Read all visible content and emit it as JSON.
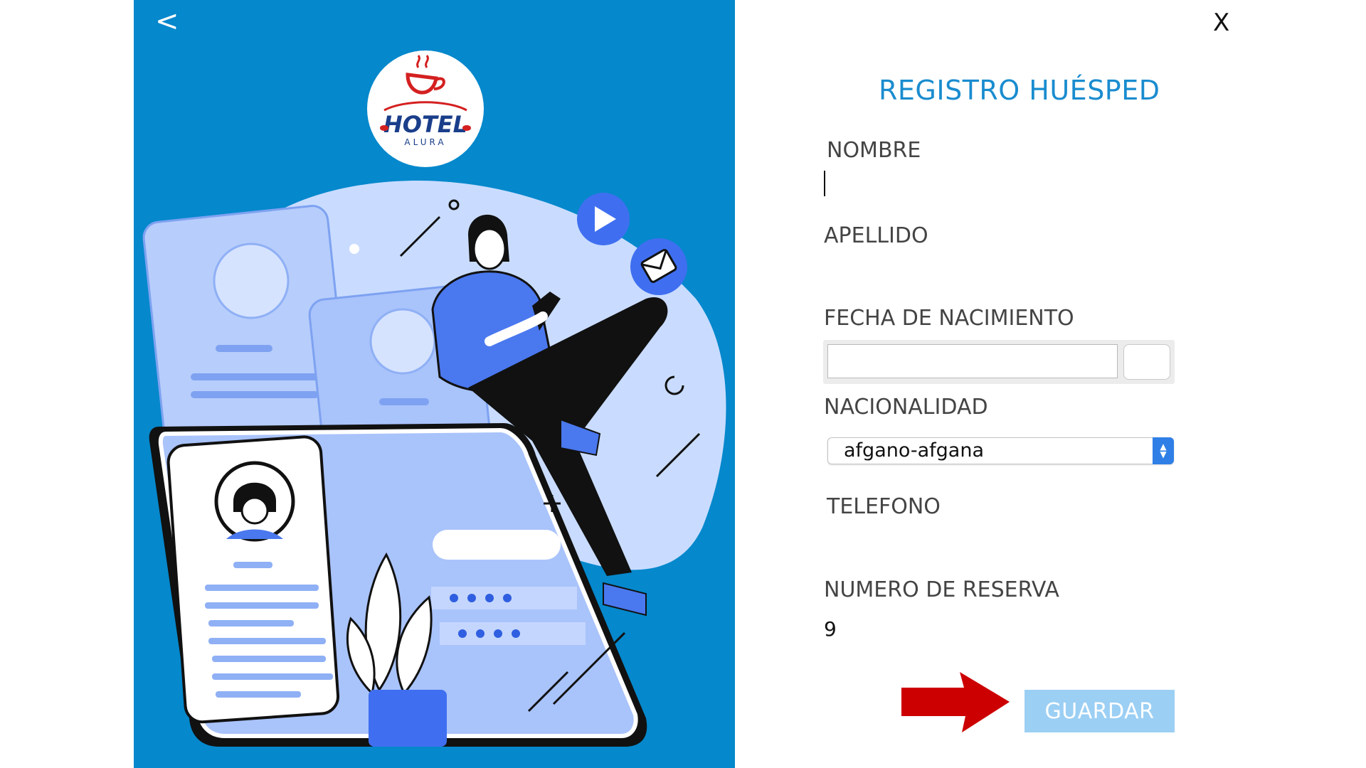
{
  "nav": {
    "back_label": "<",
    "close_label": "X"
  },
  "logo": {
    "text": "HOTEL",
    "subtext": "ALURA"
  },
  "form": {
    "title": "REGISTRO HUÉSPED",
    "nombre": {
      "label": "NOMBRE",
      "value": ""
    },
    "apellido": {
      "label": "APELLIDO",
      "value": ""
    },
    "fecha_nacimiento": {
      "label": "FECHA DE NACIMIENTO",
      "value": ""
    },
    "nacionalidad": {
      "label": "NACIONALIDAD",
      "selected": "afgano-afgana"
    },
    "telefono": {
      "label": "TELEFONO",
      "value": ""
    },
    "numero_reserva": {
      "label": "NUMERO DE RESERVA",
      "value": "9"
    },
    "save_label": "GUARDAR"
  },
  "colors": {
    "panel_blue": "#0588cc",
    "title_blue": "#1a8ccf",
    "button_light_blue": "#9ccff4",
    "annotation_red": "#cc0000"
  },
  "icons": [
    "back-chevron-icon",
    "close-x-icon",
    "play-icon",
    "mail-icon",
    "calendar-icon",
    "select-arrows-icon",
    "red-arrow-annotation"
  ]
}
